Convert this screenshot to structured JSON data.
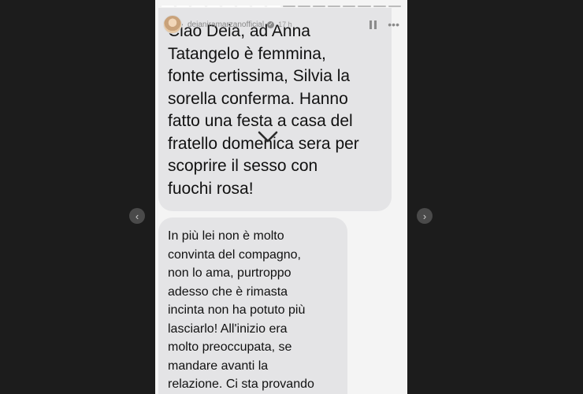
{
  "story": {
    "username": "deianiramarzanofficial",
    "time": "17 h",
    "message_1_lines": [
      "Ciao Deia,  ad Anna",
      "Tatangelo è femmina,",
      "fonte certissima, Silvia la",
      "sorella conferma. Hanno",
      "fatto una festa a casa del",
      "fratello domenica sera per",
      "scoprire il sesso con",
      "fuochi rosa!"
    ],
    "message_2_lines": [
      "In più lei non è molto",
      "convinta del compagno,",
      "non lo ama, purtroppo",
      "adesso che è rimasta",
      "incinta non ha potuto più",
      "lasciarlo! All'inizio era",
      "molto preoccupata, se",
      "mandare avanti la",
      "relazione. Ci sta provando"
    ]
  },
  "nav": {
    "prev_icon": "chevron-left-icon",
    "next_icon": "chevron-right-icon"
  },
  "controls": {
    "pause_icon": "pause-icon",
    "more_icon": "more-icon",
    "chevron_icon": "chevron-down-icon"
  },
  "colors": {
    "background": "#1c1c1c",
    "bubble": "#e4e4e6",
    "story_bg": "#f4f4f4"
  }
}
